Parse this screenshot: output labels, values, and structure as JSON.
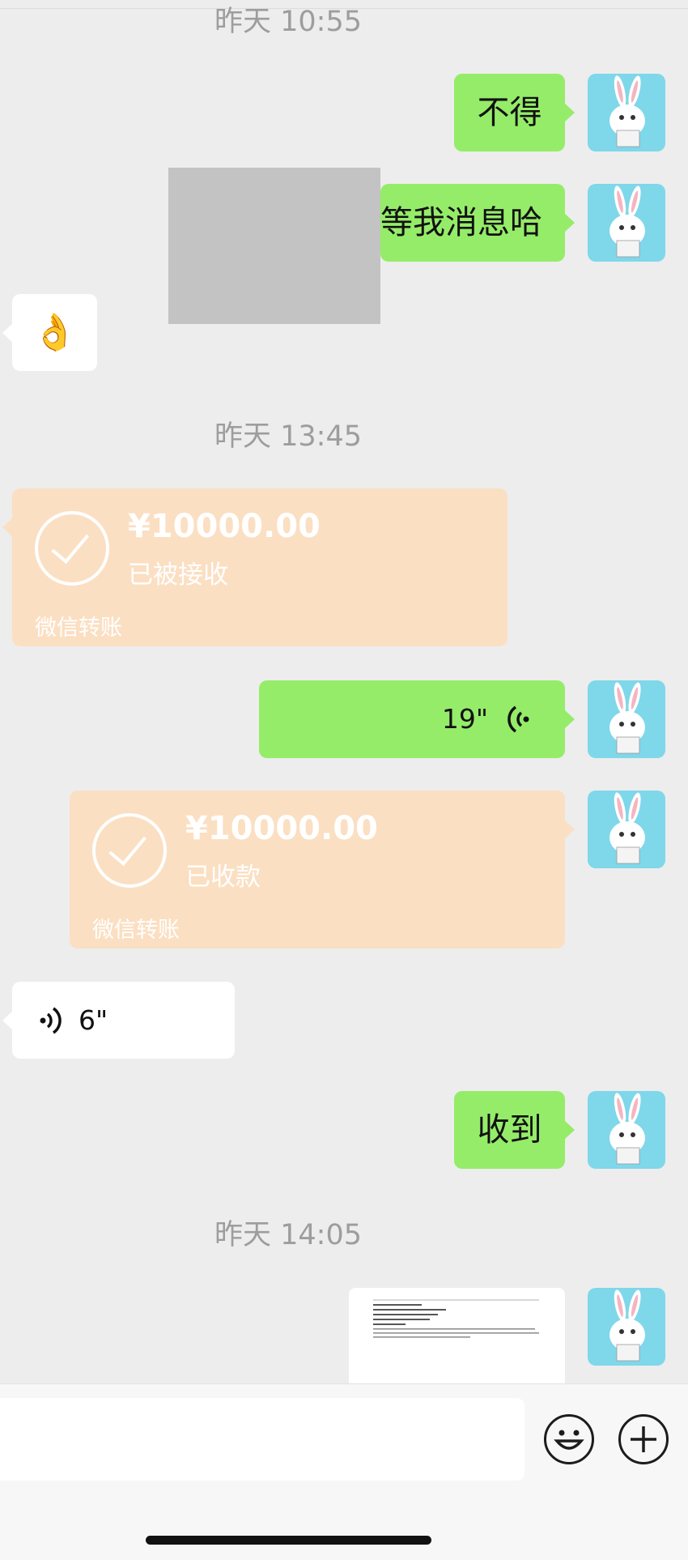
{
  "timestamps": [
    "昨天 10:55",
    "昨天 13:45",
    "昨天 14:05"
  ],
  "messages": {
    "m1_text": "不得",
    "m2_text": "等我消息哈",
    "m3_emoji": "👌",
    "m5_duration": "19\"",
    "m7_duration": "6\"",
    "m8_text": "收到"
  },
  "transfers": [
    {
      "amount": "¥10000.00",
      "status": "已被接收",
      "footer": "微信转账"
    },
    {
      "amount": "¥10000.00",
      "status": "已收款",
      "footer": "微信转账"
    }
  ],
  "icons": {
    "voice": "voice-wave-icon",
    "emoji": "emoji-smile-icon",
    "add": "plus-circle-icon",
    "check": "check-circle-icon"
  },
  "colors": {
    "background": "#ededed",
    "sent_bubble": "#95ec69",
    "received_bubble": "#ffffff",
    "transfer_bubble": "#fbdfc2",
    "avatar_bg": "#7fd7ea",
    "timestamp": "#9d9d9d",
    "placeholder_gray": "#c3c3c3"
  }
}
